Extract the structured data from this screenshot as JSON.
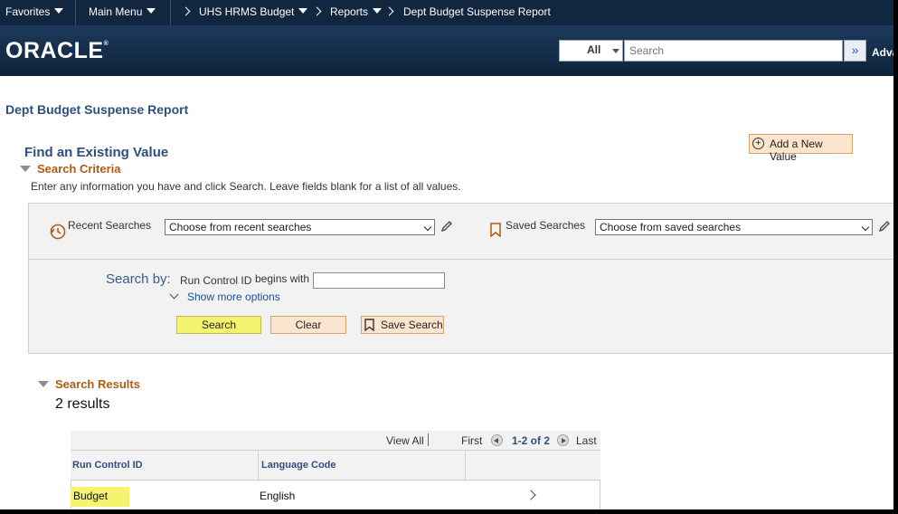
{
  "topnav": {
    "favorites": "Favorites",
    "main_menu": "Main Menu",
    "breadcrumbs": [
      "UHS HRMS Budget",
      "Reports",
      "Dept Budget Suspense Report"
    ]
  },
  "header": {
    "logo": "ORACLE",
    "search_scope": "All",
    "search_placeholder": "Search",
    "advanced": "Adva"
  },
  "page": {
    "title": "Dept Budget Suspense Report",
    "find_title": "Find an Existing Value",
    "add_new": "Add a New Value"
  },
  "criteria": {
    "label": "Search Criteria",
    "instructions": "Enter any information you have and click Search. Leave fields blank for a list of all values.",
    "recent_label": "Recent Searches",
    "recent_value": "Choose from recent searches",
    "saved_label": "Saved Searches",
    "saved_value": "Choose from saved searches",
    "search_by": "Search by:",
    "field_label": "Run Control ID",
    "operator": "begins with",
    "field_value": "",
    "show_more": "Show more options",
    "buttons": {
      "search": "Search",
      "clear": "Clear",
      "save": "Save Search"
    }
  },
  "results": {
    "label": "Search Results",
    "count": "2 results",
    "toolbar": {
      "view_all": "View All",
      "first": "First",
      "range": "1-2 of 2",
      "last": "Last"
    },
    "columns": [
      "Run Control ID",
      "Language Code"
    ],
    "rows": [
      {
        "run_control_id": "Budget",
        "language": "English"
      }
    ]
  },
  "colors": {
    "nav_bg": "#11263f",
    "accent_orange": "#b15b12",
    "highlight": "#f4f470",
    "link_blue": "#1a4fa0"
  }
}
